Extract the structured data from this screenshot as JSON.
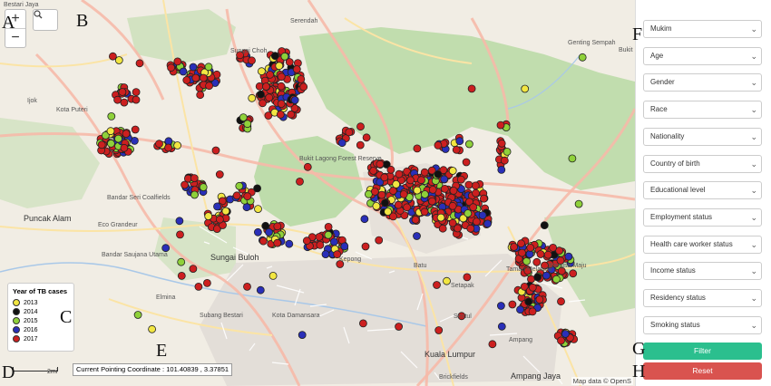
{
  "annotations": {
    "A": "A",
    "B": "B",
    "C": "C",
    "D": "D",
    "E": "E",
    "F": "F",
    "G": "G",
    "H": "H"
  },
  "map": {
    "zoom_in": "+",
    "zoom_out": "−",
    "places": [
      {
        "name": "Bestari Jaya",
        "cls": ""
      },
      {
        "name": "Serendah",
        "cls": ""
      },
      {
        "name": "Sungai Choh",
        "cls": ""
      },
      {
        "name": "Ijok",
        "cls": ""
      },
      {
        "name": "Kota Puteri",
        "cls": ""
      },
      {
        "name": "Bukit Lagong Forest Reserve",
        "cls": ""
      },
      {
        "name": "Genting Sempah",
        "cls": ""
      },
      {
        "name": "Bandar Seri Coalfields",
        "cls": ""
      },
      {
        "name": "Puncak Alam",
        "cls": "big"
      },
      {
        "name": "Eco Grandeur",
        "cls": ""
      },
      {
        "name": "Bandar Saujana Utama",
        "cls": ""
      },
      {
        "name": "Sungai Buloh",
        "cls": "big"
      },
      {
        "name": "Kepong",
        "cls": ""
      },
      {
        "name": "Batu",
        "cls": ""
      },
      {
        "name": "Setapak",
        "cls": ""
      },
      {
        "name": "Taman Melawati",
        "cls": ""
      },
      {
        "name": "Wangsa Maju",
        "cls": ""
      },
      {
        "name": "Elmina",
        "cls": ""
      },
      {
        "name": "Subang Bestari",
        "cls": ""
      },
      {
        "name": "Kota Damansara",
        "cls": ""
      },
      {
        "name": "Sentul",
        "cls": ""
      },
      {
        "name": "Kuala Lumpur",
        "cls": "big"
      },
      {
        "name": "Ampang",
        "cls": ""
      },
      {
        "name": "Ampang Jaya",
        "cls": "big"
      },
      {
        "name": "Brickfields",
        "cls": ""
      },
      {
        "name": "Bukit",
        "cls": ""
      }
    ],
    "coordinate_readout": "Current Pointing Coordinate : 101.40839 , 3.37851",
    "scale_label": "2mi",
    "attribution": "Map data © OpenS"
  },
  "legend": {
    "title": "Year of TB cases",
    "items": [
      {
        "label": "2013",
        "color": "#f2e642"
      },
      {
        "label": "2014",
        "color": "#111111"
      },
      {
        "label": "2015",
        "color": "#8fd13a"
      },
      {
        "label": "2016",
        "color": "#2a2fb8"
      },
      {
        "label": "2017",
        "color": "#cc1f1f"
      }
    ]
  },
  "filters": [
    {
      "label": "Mukim"
    },
    {
      "label": "Age"
    },
    {
      "label": "Gender"
    },
    {
      "label": "Race"
    },
    {
      "label": "Nationality"
    },
    {
      "label": "Country of birth"
    },
    {
      "label": "Educational level"
    },
    {
      "label": "Employment status"
    },
    {
      "label": "Health care worker status"
    },
    {
      "label": "Income status"
    },
    {
      "label": "Residency status"
    },
    {
      "label": "Smoking status"
    }
  ],
  "buttons": {
    "filter": {
      "label": "Filter",
      "color": "#2bbf8e"
    },
    "reset": {
      "label": "Reset",
      "color": "#d9534f"
    }
  },
  "colors": {
    "forest": "#b8d9a4",
    "road_major": "#f6b9a8",
    "road_minor": "#fbe4a5",
    "urban": "#e1dcd6"
  }
}
